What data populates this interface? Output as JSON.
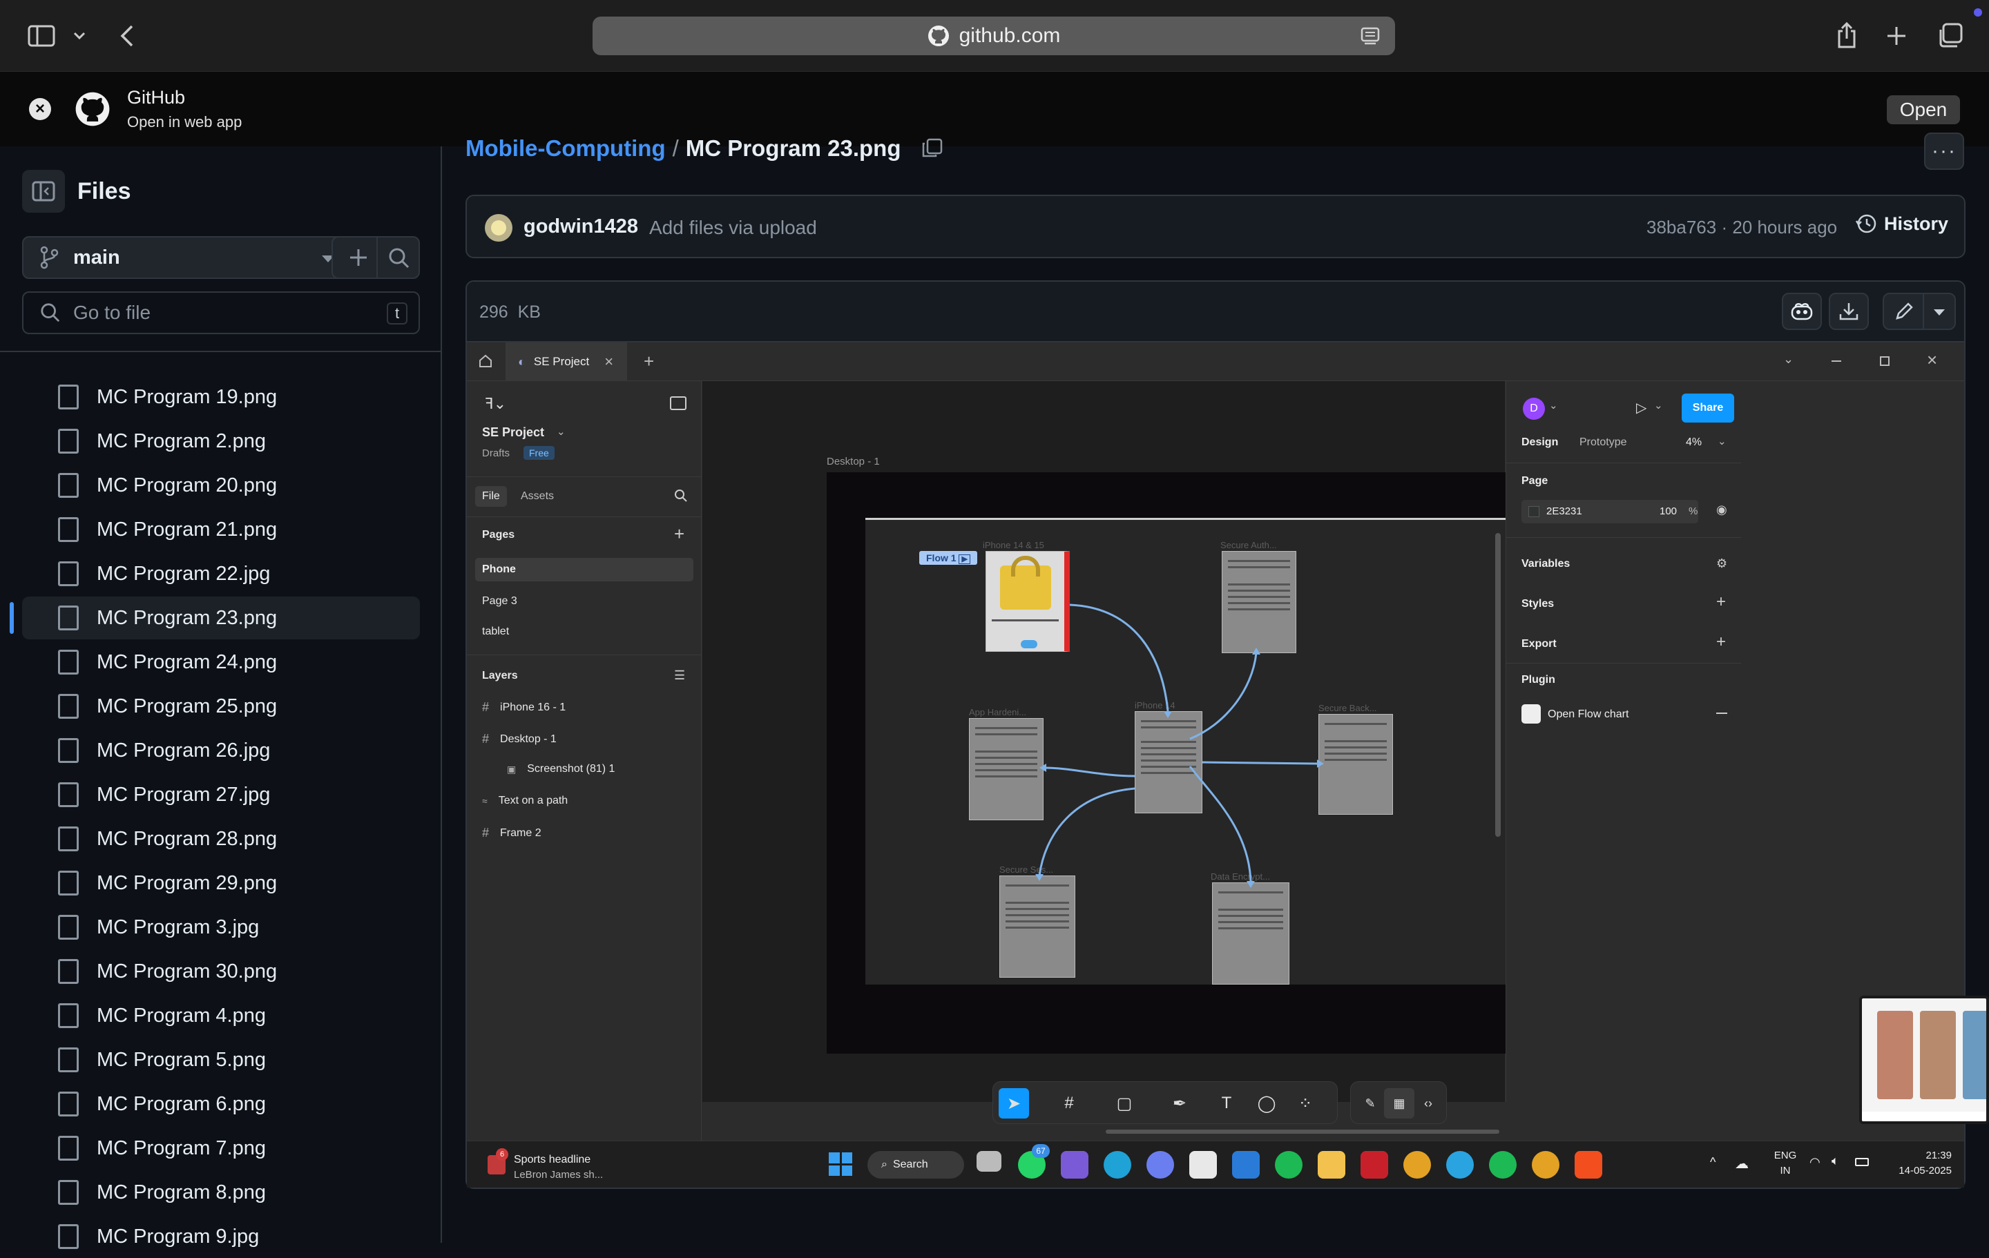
{
  "browser": {
    "url": "github.com",
    "icons": [
      "sidebar-icon",
      "chevron-down-icon",
      "back-icon",
      "share-icon",
      "plus-icon",
      "tabs-icon"
    ]
  },
  "webapp_banner": {
    "title": "GitHub",
    "subtitle": "Open in web app",
    "open_label": "Open"
  },
  "sidebar": {
    "title": "Files",
    "branch": "main",
    "search_placeholder": "Go to file",
    "search_shortcut": "t",
    "files": [
      "MC Program 19.png",
      "MC Program 2.png",
      "MC Program 20.png",
      "MC Program 21.png",
      "MC Program 22.jpg",
      "MC Program 23.png",
      "MC Program 24.png",
      "MC Program 25.png",
      "MC Program 26.jpg",
      "MC Program 27.jpg",
      "MC Program 28.png",
      "MC Program 29.png",
      "MC Program 3.jpg",
      "MC Program 30.png",
      "MC Program 4.png",
      "MC Program 5.png",
      "MC Program 6.png",
      "MC Program 7.png",
      "MC Program 8.png",
      "MC Program 9.jpg"
    ],
    "active_file": "MC Program 23.png"
  },
  "breadcrumb": {
    "repo": "Mobile-Computing",
    "separator": "/",
    "file": "MC Program 23.png"
  },
  "commit": {
    "author": "godwin1428",
    "message": "Add files via upload",
    "meta": "38ba763 · 20 hours ago",
    "history_label": "History"
  },
  "file_header": {
    "size": "296",
    "unit": "KB"
  },
  "figma": {
    "tab_title": "SE Project",
    "project_name": "SE Project",
    "drafts": "Drafts",
    "badge": "Free",
    "tabs": [
      "File",
      "Assets"
    ],
    "pages_title": "Pages",
    "pages": [
      "Phone",
      "Page 3",
      "tablet"
    ],
    "layers_title": "Layers",
    "layers": [
      "iPhone 16 - 1",
      "Desktop - 1",
      "Screenshot (81) 1",
      "Text on a path",
      "Frame 2"
    ],
    "frame_label": "Desktop - 1",
    "flow_label": "Flow 1",
    "card_labels": [
      "iPhone 14 & 15",
      "Secure Auth...",
      "App Hardeni...",
      "iPhone 14",
      "Secure Back...",
      "Secure Ses...",
      "Data Encrypt..."
    ],
    "right": {
      "avatar": "D",
      "share": "Share",
      "tabs": [
        "Design",
        "Prototype"
      ],
      "zoom": "4%",
      "page_title": "Page",
      "page_color": "2E3231",
      "page_opacity": "100",
      "percent": "%",
      "variables": "Variables",
      "styles": "Styles",
      "export": "Export",
      "plugin": "Plugin",
      "plugin_item": "Open Flow chart"
    },
    "colors": {
      "accent": "#0d99ff",
      "canvas": "#1e1e1e",
      "panel": "#2c2c2c"
    }
  },
  "taskbar": {
    "news_title": "Sports headline",
    "news_sub": "LeBron James sh...",
    "news_badge": "6",
    "search": "Search",
    "whatsapp_badge": "67",
    "lang1": "ENG",
    "lang2": "IN",
    "time": "21:39",
    "date": "14-05-2025"
  }
}
